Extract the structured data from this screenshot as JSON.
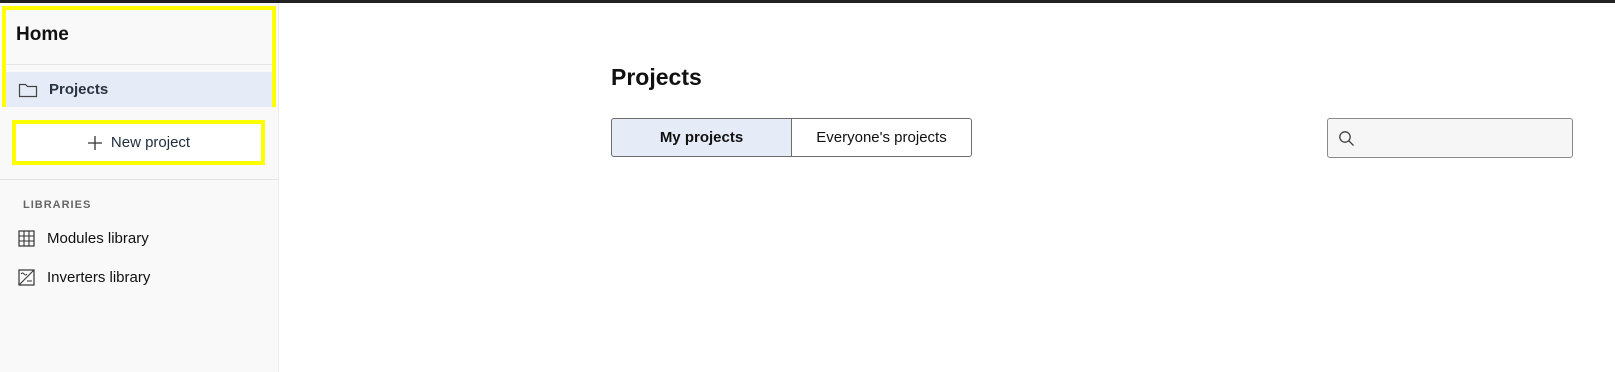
{
  "sidebar": {
    "home_title": "Home",
    "nav": [
      {
        "label": "Projects",
        "icon": "folder-icon",
        "active": true
      }
    ],
    "new_project_label": "New project",
    "libraries_heading": "LIBRARIES",
    "libraries": [
      {
        "label": "Modules library",
        "icon": "grid-icon"
      },
      {
        "label": "Inverters library",
        "icon": "inverter-icon"
      }
    ]
  },
  "main": {
    "title": "Projects",
    "tabs": [
      {
        "label": "My projects",
        "active": true
      },
      {
        "label": "Everyone's projects",
        "active": false
      }
    ],
    "search": {
      "value": "",
      "placeholder": ""
    }
  },
  "colors": {
    "highlight": "#ffff00",
    "active_bg": "#e6ecf7",
    "sidebar_bg": "#f9f9f9"
  }
}
